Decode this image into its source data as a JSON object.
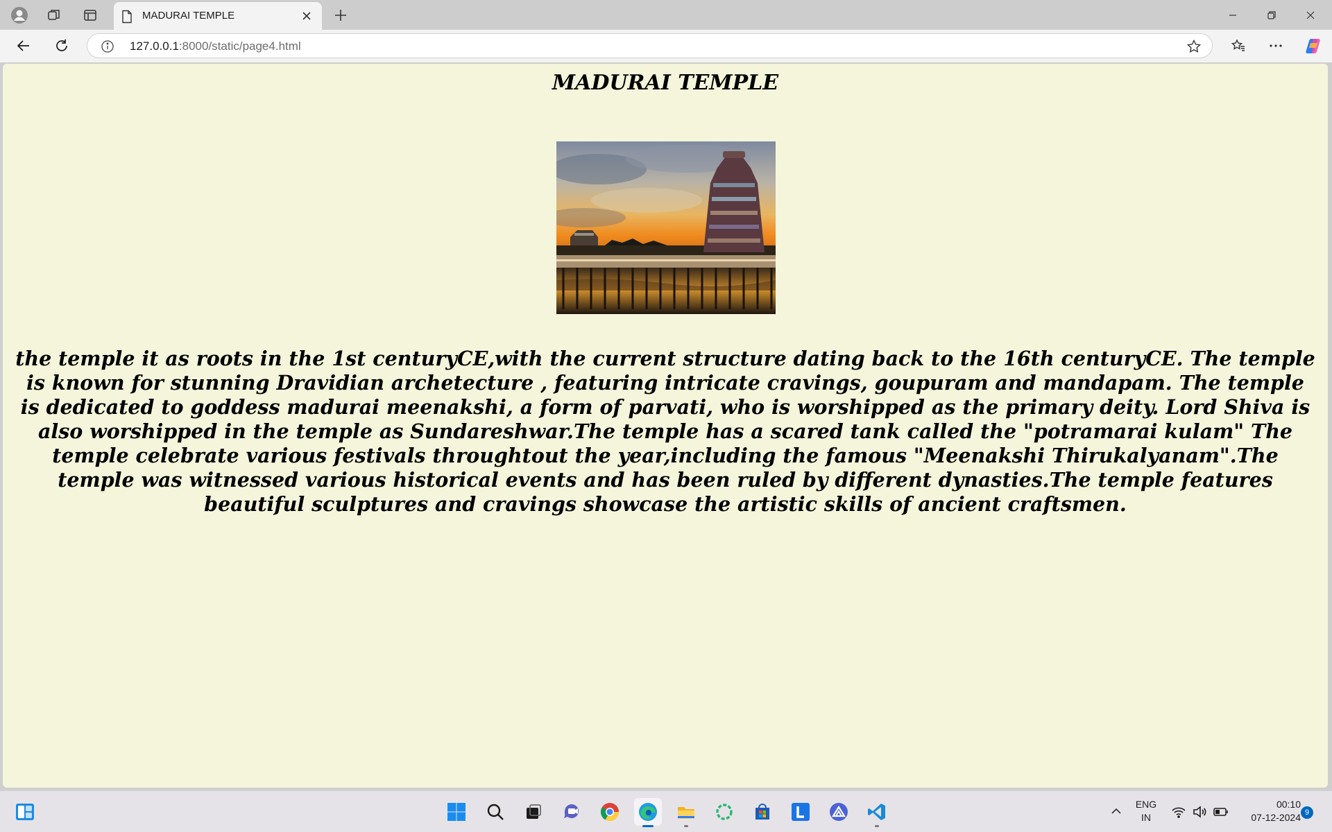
{
  "browser": {
    "tab_title": "MADURAI TEMPLE",
    "url_host": "127.0.0.1",
    "url_path": ":8000/static/page4.html"
  },
  "page": {
    "heading": "MADURAI TEMPLE",
    "image_alt": "Madurai temple gopuram painting",
    "description": "the temple it as roots in the 1st centuryCE,with the current structure dating back to the 16th centuryCE. The temple is known for stunning Dravidian archetecture , featuring intricate cravings, goupuram and mandapam. The temple is dedicated to goddess madurai meenakshi, a form of parvati, who is worshipped as the primary deity. Lord Shiva is also worshipped in the temple as Sundareshwar.The temple has a scared tank called the \"potramarai kulam\" The temple celebrate various festivals throughtout the year,including the famous \"Meenakshi Thirukalyanam\".The temple was witnessed various historical events and has been ruled by different dynasties.The temple features beautiful sculptures and cravings showcase the artistic skills of ancient craftsmen.",
    "background_color": "#f5f5dc"
  },
  "taskbar": {
    "apps": [
      "start",
      "search",
      "task-view",
      "teams",
      "chrome",
      "edge",
      "file-explorer",
      "sync-app",
      "microsoft-store",
      "l-app",
      "vpn-app",
      "vscode"
    ],
    "lang_line1": "ENG",
    "lang_line2": "IN",
    "time": "00:10",
    "date": "07-12-2024",
    "notification_count": "9"
  }
}
